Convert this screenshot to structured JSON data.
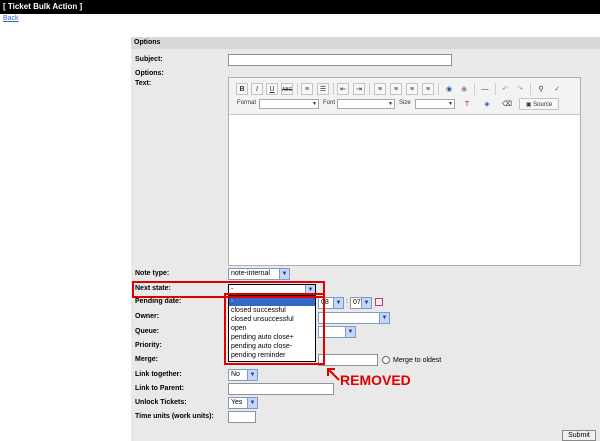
{
  "window": {
    "title": "[ Ticket Bulk Action ]"
  },
  "nav": {
    "back_label": "Back"
  },
  "form": {
    "section_title": "Options",
    "subject_label": "Subject:",
    "subject_value": "",
    "options_label": "Options:",
    "text_label": "Text:",
    "toolbar": {
      "format_label": "Format",
      "font_label": "Font",
      "size_label": "Size",
      "source_label": "Source"
    },
    "note_type_label": "Note type:",
    "note_type_value": "note-internal",
    "next_state_label": "Next state:",
    "next_state_value": "-",
    "next_state_options": [
      "-",
      "closed successful",
      "closed unsuccessful",
      "open",
      "pending auto close+",
      "pending auto close-",
      "pending reminder"
    ],
    "pending_date_label": "Pending date:",
    "pending_hour": "08",
    "pending_minute": "07",
    "owner_label": "Owner:",
    "queue_label": "Queue:",
    "priority_label": "Priority:",
    "merge_label": "Merge:",
    "merge_to_oldest_label": "Merge to oldest",
    "link_together_label": "Link together:",
    "link_together_value": "No",
    "link_to_parent_label": "Link to Parent:",
    "unlock_tickets_label": "Unlock Tickets:",
    "unlock_tickets_value": "Yes",
    "time_units_label": "Time units (work units):",
    "submit_label": "Submit"
  },
  "annotation": {
    "removed_label": "REMOVED",
    "color": "#e00000"
  }
}
